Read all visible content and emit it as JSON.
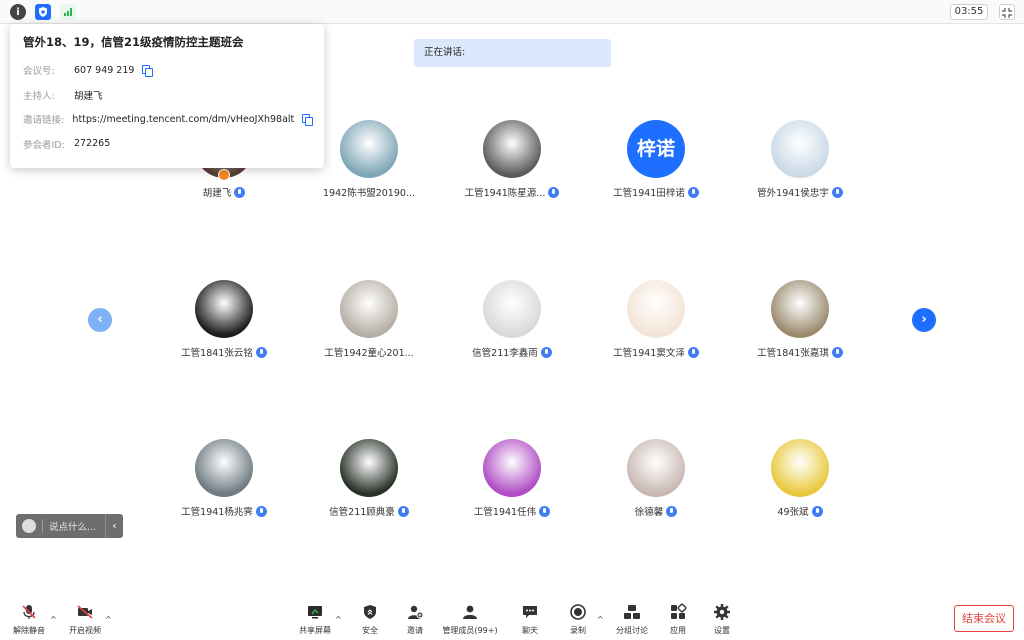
{
  "topbar": {
    "timer": "03:55",
    "colors": {
      "shield": "#1e6fff",
      "signal": "#2fb24f"
    }
  },
  "meeting_info": {
    "title": "管外18、19，信管21级疫情防控主题班会",
    "rows": [
      {
        "label": "会议号:",
        "value": "607 949 219",
        "copy": true
      },
      {
        "label": "主持人:",
        "value": "胡建飞",
        "copy": false
      },
      {
        "label": "邀请链接:",
        "value": "https://meeting.tencent.com/dm/vHeoJXh98alt",
        "copy": true
      },
      {
        "label": "参会者ID:",
        "value": "272265",
        "copy": false
      }
    ]
  },
  "speaking": {
    "label": "正在讲话:"
  },
  "participants": [
    {
      "name": "胡建飞",
      "avatar": "photo",
      "color": "#5a3f36",
      "host": true
    },
    {
      "name": "1942陈书盟20190...",
      "avatar": "photo",
      "color": "#7fa6b6",
      "mic": false
    },
    {
      "name": "工管1941陈星源...",
      "avatar": "photo",
      "color": "#5b5b5b",
      "mic": true
    },
    {
      "name": "工管1941田梓诺",
      "avatar": "text",
      "text": "梓诺",
      "color": "#1e6fff",
      "mic": true
    },
    {
      "name": "管外1941侯忠宇",
      "avatar": "photo",
      "color": "#c9d9e6",
      "mic": true
    },
    {
      "name": "工管1841张云铭",
      "avatar": "photo",
      "color": "#1d1d1d",
      "mic": true
    },
    {
      "name": "工管1942童心201...",
      "avatar": "photo",
      "color": "#b5aea3",
      "mic": false
    },
    {
      "name": "信管211李鑫雨",
      "avatar": "photo",
      "color": "#d9d9d9",
      "mic": true
    },
    {
      "name": "工管1941窦文泽",
      "avatar": "photo",
      "color": "#f3e4d6",
      "mic": true
    },
    {
      "name": "工管1841张嘉琪",
      "avatar": "photo",
      "color": "#9b8a6e",
      "mic": true
    },
    {
      "name": "工管1941杨兆霁",
      "avatar": "photo",
      "color": "#6e7b83",
      "mic": true
    },
    {
      "name": "信管211顾典豪",
      "avatar": "photo",
      "color": "#283028",
      "mic": true
    },
    {
      "name": "工管1941任伟",
      "avatar": "photo",
      "color": "#b04cc4",
      "mic": true
    },
    {
      "name": "徐德馨",
      "avatar": "photo",
      "color": "#c9b8b1",
      "mic": true
    },
    {
      "name": "49张斌",
      "avatar": "photo",
      "color": "#e8c93c",
      "mic": true
    }
  ],
  "nav": {
    "prev": "‹",
    "next": "›"
  },
  "chat": {
    "placeholder": "说点什么...",
    "collapse": "‹"
  },
  "toolbar": {
    "unmute": "解除静音",
    "start_video": "开启视频",
    "share_screen": "共享屏幕",
    "security": "安全",
    "invite": "邀请",
    "manage_members": "管理成员(99+)",
    "chat": "聊天",
    "record": "录制",
    "breakout": "分组讨论",
    "apps": "应用",
    "settings": "设置",
    "caret": "^",
    "end_meeting": "结束会议"
  },
  "accent_color": "#1e6fff",
  "danger_color": "#e0443e"
}
